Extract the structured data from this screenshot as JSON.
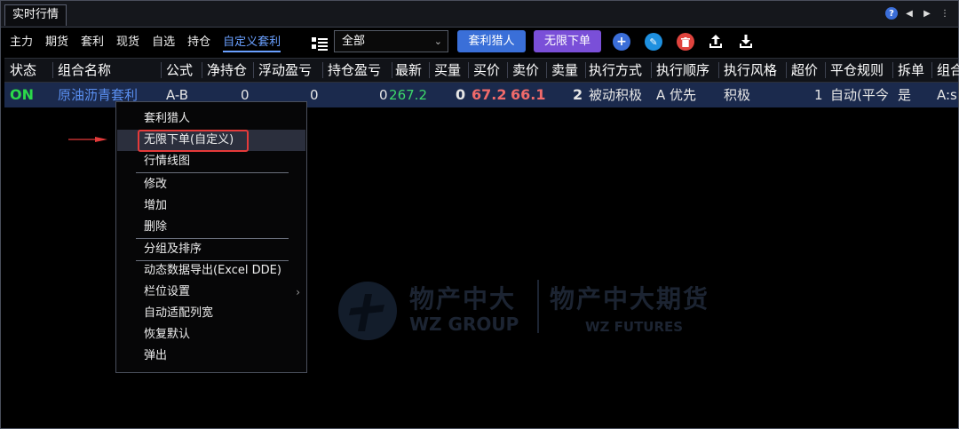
{
  "window": {
    "title": "实时行情"
  },
  "window_controls": {
    "help": "?"
  },
  "toolbar": {
    "tabs": [
      {
        "label": "主力",
        "active": false
      },
      {
        "label": "期货",
        "active": false
      },
      {
        "label": "套利",
        "active": false
      },
      {
        "label": "现货",
        "active": false
      },
      {
        "label": "自选",
        "active": false
      },
      {
        "label": "持仓",
        "active": false
      },
      {
        "label": "自定义套利",
        "active": true
      }
    ],
    "group_select": {
      "value": "全部"
    },
    "arb_hunter_button": "套利猎人",
    "unlimited_order_button": "无限下单"
  },
  "table": {
    "headers": [
      "状态",
      "组合名称",
      "公式",
      "净持仓",
      "浮动盈亏",
      "持仓盈亏",
      "最新",
      "买量",
      "买价",
      "卖价",
      "卖量",
      "执行方式",
      "执行顺序",
      "执行风格",
      "超价",
      "平仓规则",
      "拆单",
      "组合"
    ],
    "rows": [
      {
        "status": "ON",
        "name": "原油沥青套利",
        "formula": "A-B",
        "net_position": "0",
        "floating_pnl": "0",
        "position_pnl": "0",
        "last": "267.2",
        "bid_qty": "0",
        "bid": "67.2",
        "ask": "66.1",
        "ask_qty": "2",
        "exec_mode": "被动积极",
        "exec_order": "A 优先",
        "exec_style": "积极",
        "overprice": "1",
        "close_rule": "自动(平今",
        "split": "是",
        "combo": "A:s"
      }
    ]
  },
  "context_menu": {
    "items": [
      "套利猎人",
      "无限下单(自定义)",
      "行情线图",
      "修改",
      "增加",
      "删除",
      "分组及排序",
      "动态数据导出(Excel DDE)",
      "栏位设置",
      "自动适配列宽",
      "恢复默认",
      "弹出"
    ],
    "highlighted_index": 1
  },
  "watermark": {
    "cn_left": "物产中大",
    "en_left": "WZ GROUP",
    "cn_right": "物产中大期货",
    "en_right": "WZ FUTURES"
  },
  "colors": {
    "status_on": "#2bd94a",
    "name_link": "#5a8ff0",
    "bid_price": "#f06a6a",
    "ask_price": "#f06a6a",
    "last_price": "#3dd86a",
    "highlight_box": "#e53a3a",
    "arrow": "#e53a3a"
  }
}
